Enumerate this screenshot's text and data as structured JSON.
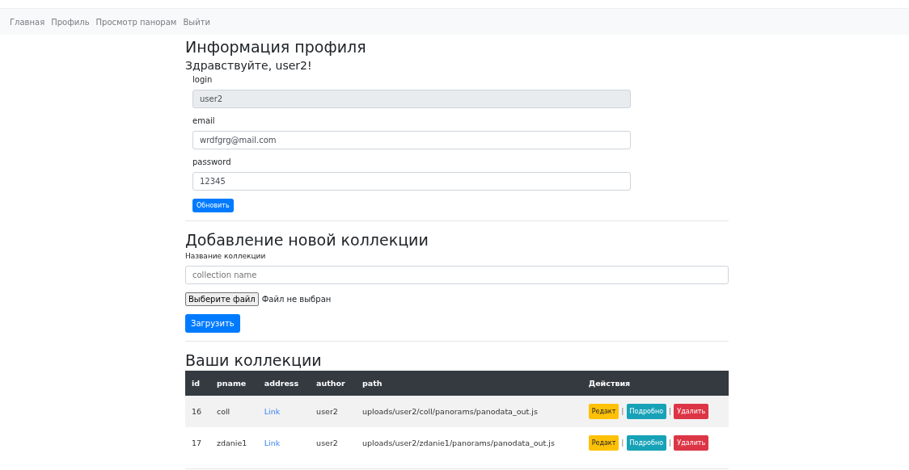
{
  "nav": {
    "links": [
      "Главная",
      "Профиль",
      "Просмотр панорам",
      "Выйти"
    ]
  },
  "profile": {
    "title": "Информация профиля",
    "greeting": "Здравствуйте, user2!",
    "fields": [
      {
        "label": "login",
        "value": "user2",
        "disabled": true
      },
      {
        "label": "email",
        "value": "wrdfgrg@mail.com",
        "disabled": false
      },
      {
        "label": "password",
        "value": "12345",
        "disabled": false
      }
    ],
    "button": "Обновить"
  },
  "add_collection": {
    "title": "Добавление новой коллекции",
    "label": "Название коллекции",
    "placeholder": "collection name",
    "file_button": "Выберите файл",
    "file_status": "Файл не выбран",
    "button": "Загрузить"
  },
  "collections": {
    "title": "Ваши коллекции",
    "columns": [
      "id",
      "pname",
      "address",
      "author",
      "path",
      "Действия"
    ],
    "rows": [
      {
        "id": "16",
        "pname": "coll",
        "address": "Link",
        "author": "user2",
        "path": "uploads/user2/coll/panorams/panodata_out.js",
        "actions": [
          {
            "kind": "warning",
            "label": "Редакт"
          },
          {
            "kind": "separator",
            "label": "|"
          },
          {
            "kind": "info",
            "label": "Подробно"
          },
          {
            "kind": "separator",
            "label": "|"
          },
          {
            "kind": "danger",
            "label": "Удалить"
          }
        ]
      },
      {
        "id": "17",
        "pname": "zdanie1",
        "address": "Link",
        "author": "user2",
        "path": "uploads/user2/zdanie1/panorams/panodata_out.js",
        "actions": [
          {
            "kind": "warning",
            "label": "Редакт"
          },
          {
            "kind": "separator",
            "label": "|"
          },
          {
            "kind": "info",
            "label": "Подробно"
          },
          {
            "kind": "separator",
            "label": "|"
          },
          {
            "kind": "danger",
            "label": "Удалить"
          }
        ]
      }
    ]
  }
}
